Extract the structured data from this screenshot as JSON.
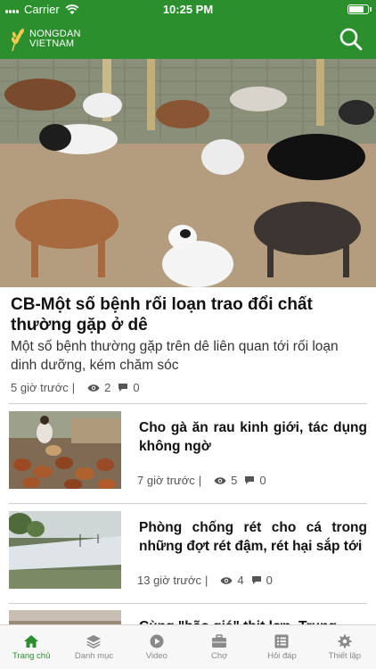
{
  "status_bar": {
    "carrier": "Carrier",
    "time": "10:25 PM",
    "battery_level": 0.85
  },
  "app_bar": {
    "logo_line1": "NONGDAN",
    "logo_line2": "VIETNAM",
    "brand_color": "#2b8f2e",
    "search_icon": "search-icon"
  },
  "featured": {
    "title": "CB-Một số bệnh rối loạn trao đổi chất thường gặp ở dê",
    "summary": "Một số bệnh thường gặp trên dê liên quan tới rối loạn dinh dưỡng, kém chăm sóc",
    "time": "5 giờ trước",
    "separator": "|",
    "views": "2",
    "comments": "0"
  },
  "articles": [
    {
      "title": "Cho gà ăn rau kinh giới, tác dụng không ngờ",
      "time": "7 giờ trước",
      "separator": "|",
      "views": "5",
      "comments": "0"
    },
    {
      "title": "Phòng chống rét cho cá trong những đợt rét đậm, rét hại sắp tới",
      "time": "13 giờ trước",
      "separator": "|",
      "views": "4",
      "comments": "0"
    },
    {
      "title": "Cùng \"bão giá\" thịt lợn, Trung"
    }
  ],
  "tabs": [
    {
      "label": "Trang chủ",
      "icon": "home-icon",
      "active": true
    },
    {
      "label": "Danh mục",
      "icon": "layers-icon",
      "active": false
    },
    {
      "label": "Video",
      "icon": "play-icon",
      "active": false
    },
    {
      "label": "Chợ",
      "icon": "briefcase-icon",
      "active": false
    },
    {
      "label": "Hỏi đáp",
      "icon": "list-icon",
      "active": false
    },
    {
      "label": "Thiết lập",
      "icon": "gear-icon",
      "active": false
    }
  ]
}
